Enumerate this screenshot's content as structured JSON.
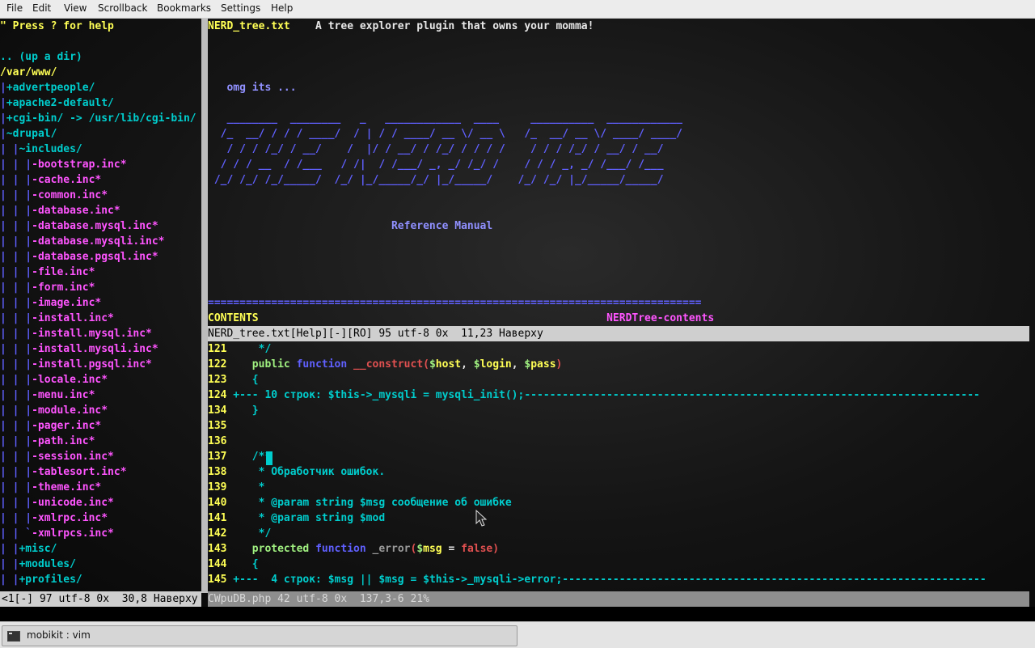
{
  "menu": [
    "File",
    "Edit",
    "View",
    "Scrollback",
    "Bookmarks",
    "Settings",
    "Help"
  ],
  "colors": {
    "cyan": "#00cdcd",
    "yellow": "#ffff55",
    "magenta": "#ff55ff",
    "blue": "#6060ff",
    "green": "#a0f080",
    "red": "#e05050",
    "grey": "#9a9a9a",
    "statusbar": "#cfcfcf",
    "statusInactive": "#8e8e8e",
    "text": "#e8e8e8",
    "white": "#ffffff",
    "purple": "#9090ff"
  },
  "tree": {
    "lines": [
      [
        [
          "\" Press ? for help",
          "yellow"
        ]
      ],
      [],
      [
        [
          ".. (up a dir)",
          "cyan"
        ]
      ],
      [
        [
          "/var/www/",
          "yellow"
        ]
      ],
      [
        [
          "|",
          "blue"
        ],
        [
          "+advertpeople/",
          "cyan"
        ]
      ],
      [
        [
          "|",
          "blue"
        ],
        [
          "+apache2-default/",
          "cyan"
        ]
      ],
      [
        [
          "|",
          "blue"
        ],
        [
          "+cgi-bin/ -> /usr/lib/cgi-bin/",
          "cyan"
        ]
      ],
      [
        [
          "|",
          "blue"
        ],
        [
          "~drupal/",
          "cyan"
        ]
      ],
      [
        [
          "| |",
          "blue"
        ],
        [
          "~includes/",
          "cyan"
        ]
      ],
      [
        [
          "| | |",
          "blue"
        ],
        [
          "-bootstrap.inc*",
          "magenta"
        ]
      ],
      [
        [
          "| | |",
          "blue"
        ],
        [
          "-cache.inc*",
          "magenta"
        ]
      ],
      [
        [
          "| | |",
          "blue"
        ],
        [
          "-common.inc*",
          "magenta"
        ]
      ],
      [
        [
          "| | |",
          "blue"
        ],
        [
          "-database.inc*",
          "magenta"
        ]
      ],
      [
        [
          "| | |",
          "blue"
        ],
        [
          "-database.mysql.inc*",
          "magenta"
        ]
      ],
      [
        [
          "| | |",
          "blue"
        ],
        [
          "-database.mysqli.inc*",
          "magenta"
        ]
      ],
      [
        [
          "| | |",
          "blue"
        ],
        [
          "-database.pgsql.inc*",
          "magenta"
        ]
      ],
      [
        [
          "| | |",
          "blue"
        ],
        [
          "-file.inc*",
          "magenta"
        ]
      ],
      [
        [
          "| | |",
          "blue"
        ],
        [
          "-form.inc*",
          "magenta"
        ]
      ],
      [
        [
          "| | |",
          "blue"
        ],
        [
          "-image.inc*",
          "magenta"
        ]
      ],
      [
        [
          "| | |",
          "blue"
        ],
        [
          "-install.inc*",
          "magenta"
        ]
      ],
      [
        [
          "| | |",
          "blue"
        ],
        [
          "-install.mysql.inc*",
          "magenta"
        ]
      ],
      [
        [
          "| | |",
          "blue"
        ],
        [
          "-install.mysqli.inc*",
          "magenta"
        ]
      ],
      [
        [
          "| | |",
          "blue"
        ],
        [
          "-install.pgsql.inc*",
          "magenta"
        ]
      ],
      [
        [
          "| | |",
          "blue"
        ],
        [
          "-locale.inc*",
          "magenta"
        ]
      ],
      [
        [
          "| | |",
          "blue"
        ],
        [
          "-menu.inc*",
          "magenta"
        ]
      ],
      [
        [
          "| | |",
          "blue"
        ],
        [
          "-module.inc*",
          "magenta"
        ]
      ],
      [
        [
          "| | |",
          "blue"
        ],
        [
          "-pager.inc*",
          "magenta"
        ]
      ],
      [
        [
          "| | |",
          "blue"
        ],
        [
          "-path.inc*",
          "magenta"
        ]
      ],
      [
        [
          "| | |",
          "blue"
        ],
        [
          "-session.inc*",
          "magenta"
        ]
      ],
      [
        [
          "| | |",
          "blue"
        ],
        [
          "-tablesort.inc*",
          "magenta"
        ]
      ],
      [
        [
          "| | |",
          "blue"
        ],
        [
          "-theme.inc*",
          "magenta"
        ]
      ],
      [
        [
          "| | |",
          "blue"
        ],
        [
          "-unicode.inc*",
          "magenta"
        ]
      ],
      [
        [
          "| | |",
          "blue"
        ],
        [
          "-xmlrpc.inc*",
          "magenta"
        ]
      ],
      [
        [
          "| | `",
          "blue"
        ],
        [
          "-xmlrpcs.inc*",
          "magenta"
        ]
      ],
      [
        [
          "| |",
          "blue"
        ],
        [
          "+misc/",
          "cyan"
        ]
      ],
      [
        [
          "| |",
          "blue"
        ],
        [
          "+modules/",
          "cyan"
        ]
      ],
      [
        [
          "| |",
          "blue"
        ],
        [
          "+profiles/",
          "cyan"
        ]
      ]
    ],
    "status": "<1[-] 97 utf-8 0x  30,8 Наверху"
  },
  "help": {
    "lines": [
      [
        [
          "NERD_tree.txt",
          "yellow"
        ],
        [
          "    A tree explorer plugin that owns your momma!",
          "text"
        ]
      ],
      [],
      [],
      [],
      [
        [
          "   omg its ...",
          "purple"
        ]
      ],
      [],
      [
        [
          "   ________  ________   _   ____________  ____     __________  ____________",
          "blue"
        ]
      ],
      [
        [
          "  /_  __/ / / / ____/  / | / / ____/ __ \\/ __ \\   /_  __/ __ \\/ ____/ ____/",
          "blue"
        ]
      ],
      [
        [
          "   / / / /_/ / __/    /  |/ / __/ / /_/ / / / /    / / / /_/ / __/ / __/",
          "blue"
        ]
      ],
      [
        [
          "  / / / __  / /___   / /|  / /___/ _, _/ /_/ /    / / / _, _/ /___/ /___",
          "blue"
        ]
      ],
      [
        [
          " /_/ /_/ /_/_____/  /_/ |_/_____/_/ |_/_____/    /_/ /_/ |_/_____/_____/",
          "blue"
        ]
      ],
      [],
      [],
      [
        [
          "                             Reference Manual",
          "purple"
        ]
      ],
      [],
      [],
      [],
      [],
      [
        [
          "==============================================================================",
          "blue"
        ]
      ],
      [
        [
          "CONTENTS",
          "yellow"
        ],
        [
          "                                                       NERDTree-contents",
          "magenta"
        ]
      ]
    ],
    "status": "NERD_tree.txt[Help][-][RO] 95 utf-8 0x  11,23 Наверху"
  },
  "code": {
    "lines": [
      [
        [
          "121",
          "yellow"
        ],
        [
          "     */",
          "cyan"
        ]
      ],
      [
        [
          "122",
          "yellow"
        ],
        [
          "    ",
          "text"
        ],
        [
          "public",
          "green"
        ],
        [
          " ",
          "text"
        ],
        [
          "function",
          "blue"
        ],
        [
          " ",
          "text"
        ],
        [
          "__construct",
          "red"
        ],
        [
          "(",
          "red"
        ],
        [
          "$",
          "green"
        ],
        [
          "host",
          "yellow"
        ],
        [
          ", ",
          "text"
        ],
        [
          "$",
          "green"
        ],
        [
          "login",
          "yellow"
        ],
        [
          ", ",
          "text"
        ],
        [
          "$",
          "green"
        ],
        [
          "pass",
          "yellow"
        ],
        [
          ")",
          "red"
        ]
      ],
      [
        [
          "123",
          "yellow"
        ],
        [
          "    {",
          "cyan"
        ]
      ],
      [
        [
          "124",
          "yellow"
        ],
        [
          " +--- 10 строк: $this->_mysqli = mysqli_init();------------------------------------------------------------------------",
          "cyan"
        ]
      ],
      [
        [
          "134",
          "yellow"
        ],
        [
          "    }",
          "cyan"
        ]
      ],
      [
        [
          "135",
          "yellow"
        ]
      ],
      [
        [
          "136",
          "yellow"
        ]
      ],
      [
        [
          "137",
          "yellow"
        ],
        [
          "    /**",
          "cyan"
        ]
      ],
      [
        [
          "138",
          "yellow"
        ],
        [
          "     * Обработчик ошибок.",
          "cyan"
        ]
      ],
      [
        [
          "139",
          "yellow"
        ],
        [
          "     *",
          "cyan"
        ]
      ],
      [
        [
          "140",
          "yellow"
        ],
        [
          "     * @param string $msg сообщение об ошибке",
          "cyan"
        ]
      ],
      [
        [
          "141",
          "yellow"
        ],
        [
          "     * @param string $mod",
          "cyan"
        ]
      ],
      [
        [
          "142",
          "yellow"
        ],
        [
          "     */",
          "cyan"
        ]
      ],
      [
        [
          "143",
          "yellow"
        ],
        [
          "    ",
          "text"
        ],
        [
          "protected",
          "green"
        ],
        [
          " ",
          "text"
        ],
        [
          "function",
          "blue"
        ],
        [
          " ",
          "text"
        ],
        [
          "_error",
          "grey"
        ],
        [
          "(",
          "red"
        ],
        [
          "$",
          "green"
        ],
        [
          "msg",
          "yellow"
        ],
        [
          " = ",
          "text"
        ],
        [
          "false",
          "red"
        ],
        [
          ")",
          "red"
        ]
      ],
      [
        [
          "144",
          "yellow"
        ],
        [
          "    {",
          "cyan"
        ]
      ],
      [
        [
          "145",
          "yellow"
        ],
        [
          " +---  4 строк: $msg || $msg = $this->_mysqli->error;-------------------------------------------------------------------",
          "cyan"
        ]
      ]
    ],
    "status": "CWpuDB.php 42 utf-8 0x  137,3-6 21%"
  },
  "taskbar": {
    "task_label": "mobikit : vim",
    "icon": "terminal-icon"
  }
}
